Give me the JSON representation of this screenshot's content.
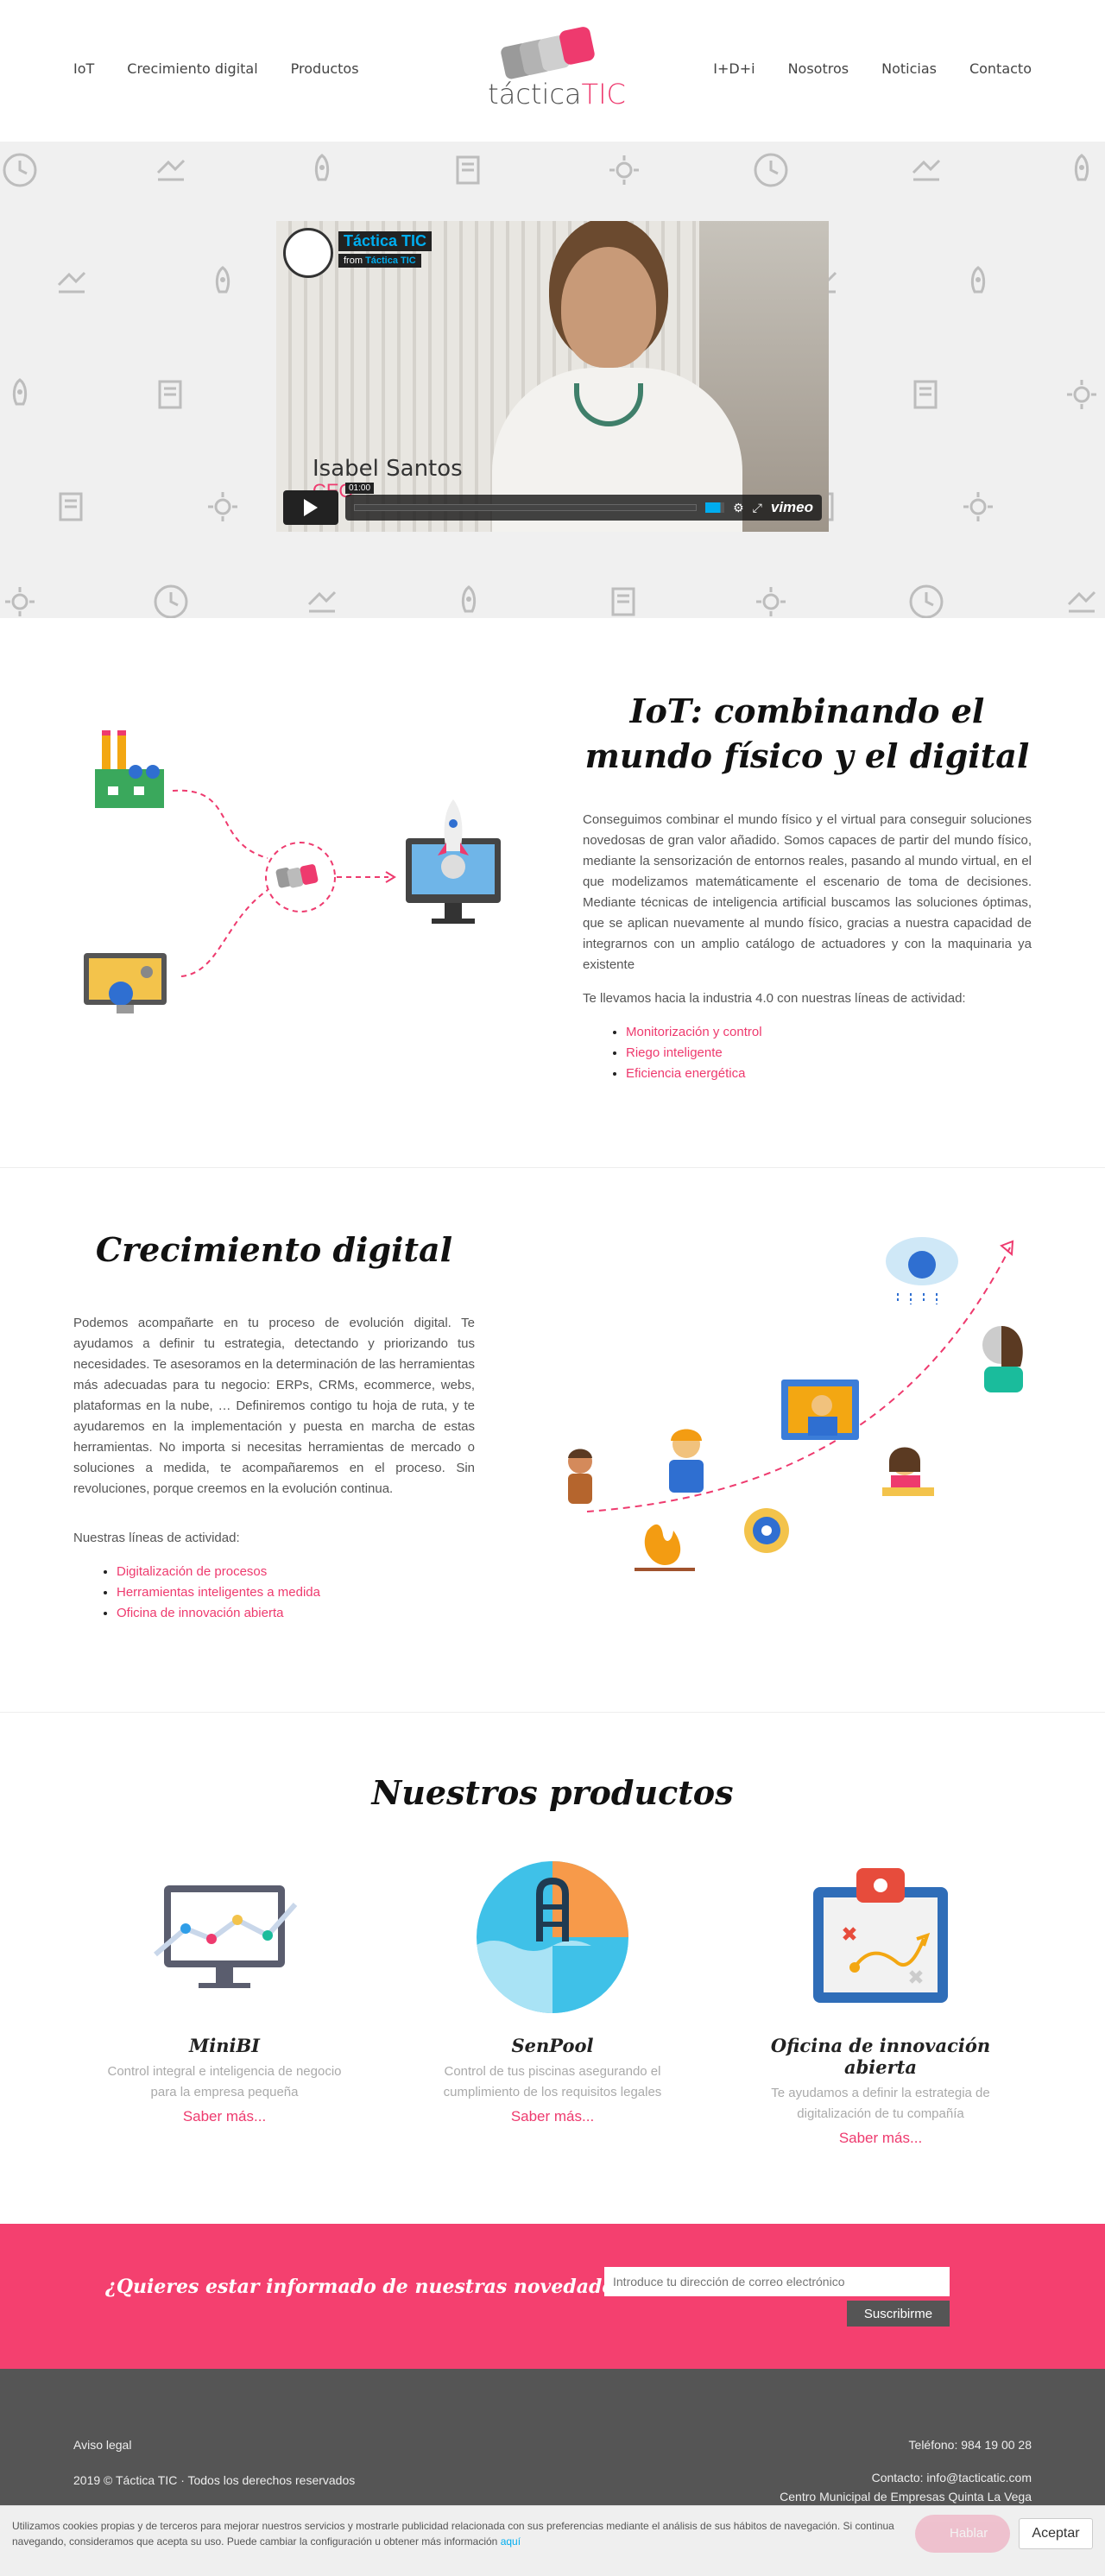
{
  "nav": {
    "left": [
      "IoT",
      "Crecimiento digital",
      "Productos"
    ],
    "right": [
      "I+D+i",
      "Nosotros",
      "Noticias",
      "Contacto"
    ]
  },
  "logo": {
    "text_main": "táctica",
    "text_accent": "TIC"
  },
  "video": {
    "title": "Táctica TIC",
    "from_label": "from",
    "from_name": "Táctica TIC",
    "person_name": "Isabel Santos",
    "person_role": "CEO",
    "time": "01:00",
    "brand": "vimeo"
  },
  "iot": {
    "title": "IoT: combinando el mundo físico y el digital",
    "body": "Conseguimos combinar el mundo físico y el virtual para conseguir soluciones novedosas de gran valor añadido. Somos capaces de partir del mundo físico, mediante la sensorización de entornos reales, pasando al mundo virtual, en el que modelizamos matemáticamente el escenario de toma de decisiones. Mediante técnicas de inteligencia artificial buscamos las soluciones óptimas, que se aplican nuevamente al mundo físico, gracias a nuestra capacidad de integrarnos con un amplio catálogo de actuadores y con la maquinaria ya existente",
    "lead": "Te llevamos hacia la industria 4.0 con nuestras líneas de actividad:",
    "items": [
      "Monitorización y control",
      "Riego inteligente",
      "Eficiencia energética"
    ]
  },
  "digital": {
    "title": "Crecimiento digital",
    "body": "Podemos acompañarte en tu proceso de evolución digital. Te ayudamos a definir tu estrategia, detectando y priorizando tus necesidades. Te asesoramos en la determinación de las herramientas más adecuadas para tu negocio: ERPs, CRMs, ecommerce, webs, plataformas en la nube, … Definiremos contigo tu hoja de ruta, y te ayudaremos en la implementación y puesta en marcha de estas herramientas. No importa si necesitas herramientas de mercado o soluciones a medida, te acompañaremos en el proceso. Sin revoluciones, porque creemos en la evolución continua.",
    "lead": "Nuestras líneas de actividad:",
    "items": [
      "Digitalización de procesos",
      "Herramientas inteligentes a medida",
      "Oficina de innovación abierta"
    ]
  },
  "products": {
    "title": "Nuestros productos",
    "items": [
      {
        "name": "MiniBI",
        "desc": "Control integral e inteligencia de negocio para la empresa pequeña",
        "link": "Saber más..."
      },
      {
        "name": "SenPool",
        "desc": "Control de tus piscinas asegurando el cumplimiento de los requisitos legales",
        "link": "Saber más..."
      },
      {
        "name": "Oficina de innovación abierta",
        "desc": "Te ayudamos a definir la estrategia de digitalización de tu compañía",
        "link": "Saber más..."
      }
    ]
  },
  "newsletter": {
    "question": "¿Quieres estar informado de nuestras novedades?",
    "placeholder": "Introduce tu dirección de correo electrónico",
    "button": "Suscribirme"
  },
  "footer": {
    "legal": "Aviso legal",
    "copyright": "2019 © Táctica TIC · Todos los derechos reservados",
    "phone": "Teléfono: 984 19 00 28",
    "email": "Contacto: info@tacticatic.com",
    "address": "Centro Municipal de Empresas Quinta La Vega"
  },
  "cookie": {
    "text": "Utilizamos cookies propias y de terceros para mejorar nuestros servicios y mostrarle publicidad relacionada con sus preferencias mediante el análisis de sus hábitos de navegación. Si continua navegando, consideramos que acepta su uso. Puede cambiar la configuración u obtener más información",
    "link": "aquí",
    "accept": "Aceptar",
    "chat": "Hablar"
  },
  "colors": {
    "accent": "#ee3a6e",
    "dark": "#555555",
    "newsletter_bg": "#f4406f",
    "video_blue": "#00adef"
  }
}
